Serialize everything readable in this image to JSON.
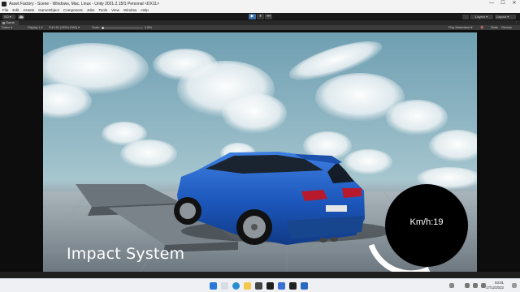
{
  "window": {
    "title": "Asset Factory - Scene - Windows, Mac, Linux - Unity 2021.2.15f1 Personal <DX11>",
    "controls": [
      "—",
      "☐",
      "✕"
    ]
  },
  "menu": {
    "items": [
      "File",
      "Edit",
      "Assets",
      "GameObject",
      "Component",
      "Jobs",
      "Tools",
      "View",
      "Window",
      "Help"
    ]
  },
  "toolbar": {
    "account": "SO",
    "layers_label": "Layers",
    "layout_label": "Layout",
    "play_icons": [
      "▶",
      "⏸",
      "⏭"
    ]
  },
  "game_tab": {
    "label": "Game"
  },
  "game_bar": {
    "mode": "Game",
    "display": "Display 1",
    "resolution": "Full HD (1920x1080)",
    "scale_label": "Scale",
    "scale_value": "0.83x",
    "play_maximized": "Play Maximized",
    "stats": "Stats",
    "gizmos": "Gizmos"
  },
  "hud": {
    "title": "Impact System",
    "speed_text": "Km/h:19"
  },
  "taskbar": {
    "time": "03:01",
    "date": "17/12/2022"
  },
  "colors": {
    "play_active": "#3d6ea8",
    "car_body": "#1f5fc4",
    "speedo": "#000000",
    "speed_arc": "#ffffff"
  }
}
